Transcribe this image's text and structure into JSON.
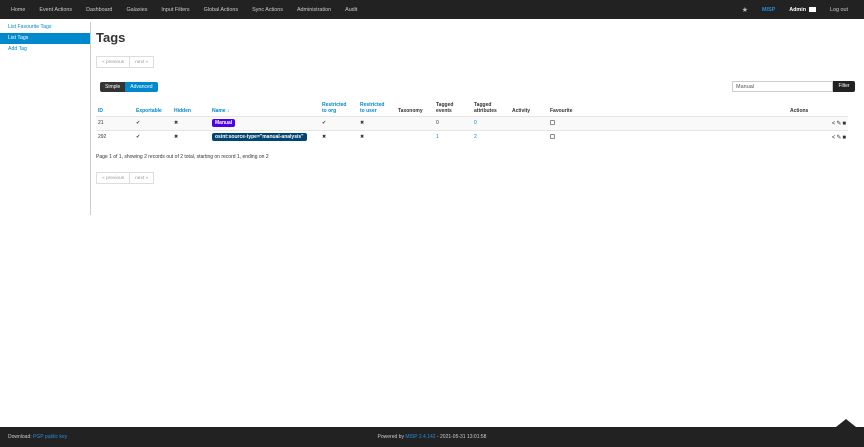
{
  "nav": {
    "items": [
      "Home",
      "Event Actions",
      "Dashboard",
      "Galaxies",
      "Input Filters",
      "Global Actions",
      "Sync Actions",
      "Administration",
      "Audit"
    ],
    "brand": "MISP",
    "user": "Admin",
    "logout": "Log out"
  },
  "sidebar": {
    "items": [
      "List Favourite Tags",
      "List Tags",
      "Add Tag"
    ]
  },
  "page": {
    "title": "Tags",
    "prev": "« previous",
    "next": "next »",
    "toggle_simple": "Simple",
    "toggle_advanced": "Advanced",
    "filter_value": "Manual",
    "filter_button": "Filter",
    "page_info": "Page 1 of 1, showing 2 records out of 2 total, starting on record 1, ending on 2"
  },
  "table": {
    "headers": {
      "id": "ID",
      "exportable": "Exportable",
      "hidden": "Hidden",
      "name": "Name ↓",
      "restricted_org_1": "Restricted",
      "restricted_org_2": "to org",
      "restricted_user_1": "Restricted",
      "restricted_user_2": "to user",
      "taxonomy": "Taxonomy",
      "tagged_events_1": "Tagged",
      "tagged_events_2": "events",
      "tagged_attrs_1": "Tagged",
      "tagged_attrs_2": "attributes",
      "activity": "Activity",
      "favourite": "Favourite",
      "actions": "Actions"
    },
    "rows": [
      {
        "id": "21",
        "exportable": "✔",
        "hidden": "✖",
        "name": "Manual",
        "tag_color": "#4f00ea",
        "restricted_org": "✔",
        "restricted_user": "✖",
        "taxonomy": "",
        "tagged_events": "0",
        "tagged_attributes": "0"
      },
      {
        "id": "292",
        "exportable": "✔",
        "hidden": "✖",
        "name": "osint:source-type=\"manual-analysis\"",
        "tag_color": "#004573",
        "restricted_org": "✖",
        "restricted_user": "✖",
        "taxonomy": "",
        "tagged_events": "1",
        "tagged_attributes": "2"
      }
    ]
  },
  "footer": {
    "download_label": "Download:",
    "download_link": "PGP public key",
    "powered_prefix": "Powered by",
    "powered_link": "MISP 2.4.142",
    "powered_suffix": "- 2021-05-31 13:01:58"
  }
}
